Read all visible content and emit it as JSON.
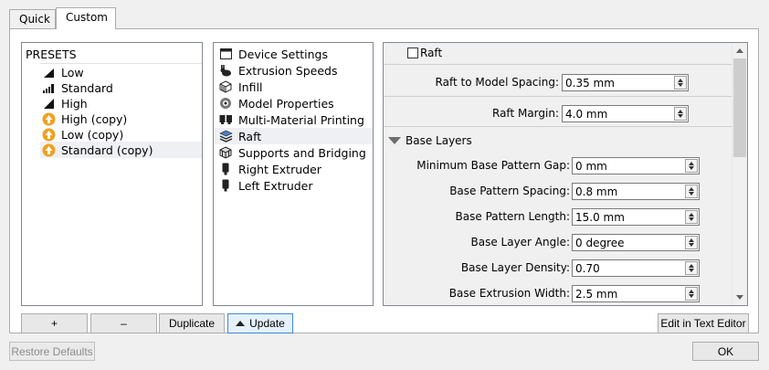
{
  "tabs": [
    {
      "label": "Quick"
    },
    {
      "label": "Custom"
    }
  ],
  "presets": {
    "header": "PRESETS",
    "items": [
      {
        "label": "Low",
        "icon": "signal-bars-low-icon"
      },
      {
        "label": "Standard",
        "icon": "signal-bars-medium-icon"
      },
      {
        "label": "High",
        "icon": "signal-bars-high-icon"
      },
      {
        "label": "High (copy)",
        "icon": "custom-preset-icon"
      },
      {
        "label": "Low (copy)",
        "icon": "custom-preset-icon"
      },
      {
        "label": "Standard (copy)",
        "icon": "custom-preset-icon"
      }
    ],
    "buttons": {
      "add": "+",
      "remove": "–",
      "duplicate": "Duplicate",
      "update": "Update"
    }
  },
  "categories": [
    {
      "label": "Device Settings",
      "icon": "window-icon"
    },
    {
      "label": "Extrusion Speeds",
      "icon": "rabbit-icon"
    },
    {
      "label": "Infill",
      "icon": "infill-cube-icon"
    },
    {
      "label": "Model Properties",
      "icon": "model-properties-icon"
    },
    {
      "label": "Multi-Material Printing",
      "icon": "multi-material-icon"
    },
    {
      "label": "Raft",
      "icon": "raft-layers-icon"
    },
    {
      "label": "Supports and Bridging",
      "icon": "supports-cube-icon"
    },
    {
      "label": "Right Extruder",
      "icon": "extruder-icon"
    },
    {
      "label": "Left Extruder",
      "icon": "extruder-icon"
    }
  ],
  "raft": {
    "checkbox_label": "Raft",
    "spacing_label": "Raft to Model Spacing:",
    "spacing_value": "0.35 mm",
    "margin_label": "Raft Margin:",
    "margin_value": "4.0 mm",
    "section_title": "Base Layers",
    "fields": [
      {
        "label": "Minimum Base Pattern Gap:",
        "value": "0 mm"
      },
      {
        "label": "Base Pattern Spacing:",
        "value": "0.8 mm"
      },
      {
        "label": "Base Pattern Length:",
        "value": "15.0 mm"
      },
      {
        "label": "Base Layer Angle:",
        "value": "0 degree"
      },
      {
        "label": "Base Layer Density:",
        "value": "0.70"
      },
      {
        "label": "Base Extrusion Width:",
        "value": "2.5 mm"
      }
    ],
    "edit_button": "Edit in Text Editor"
  },
  "footer": {
    "restore": "Restore Defaults",
    "ok": "OK"
  }
}
